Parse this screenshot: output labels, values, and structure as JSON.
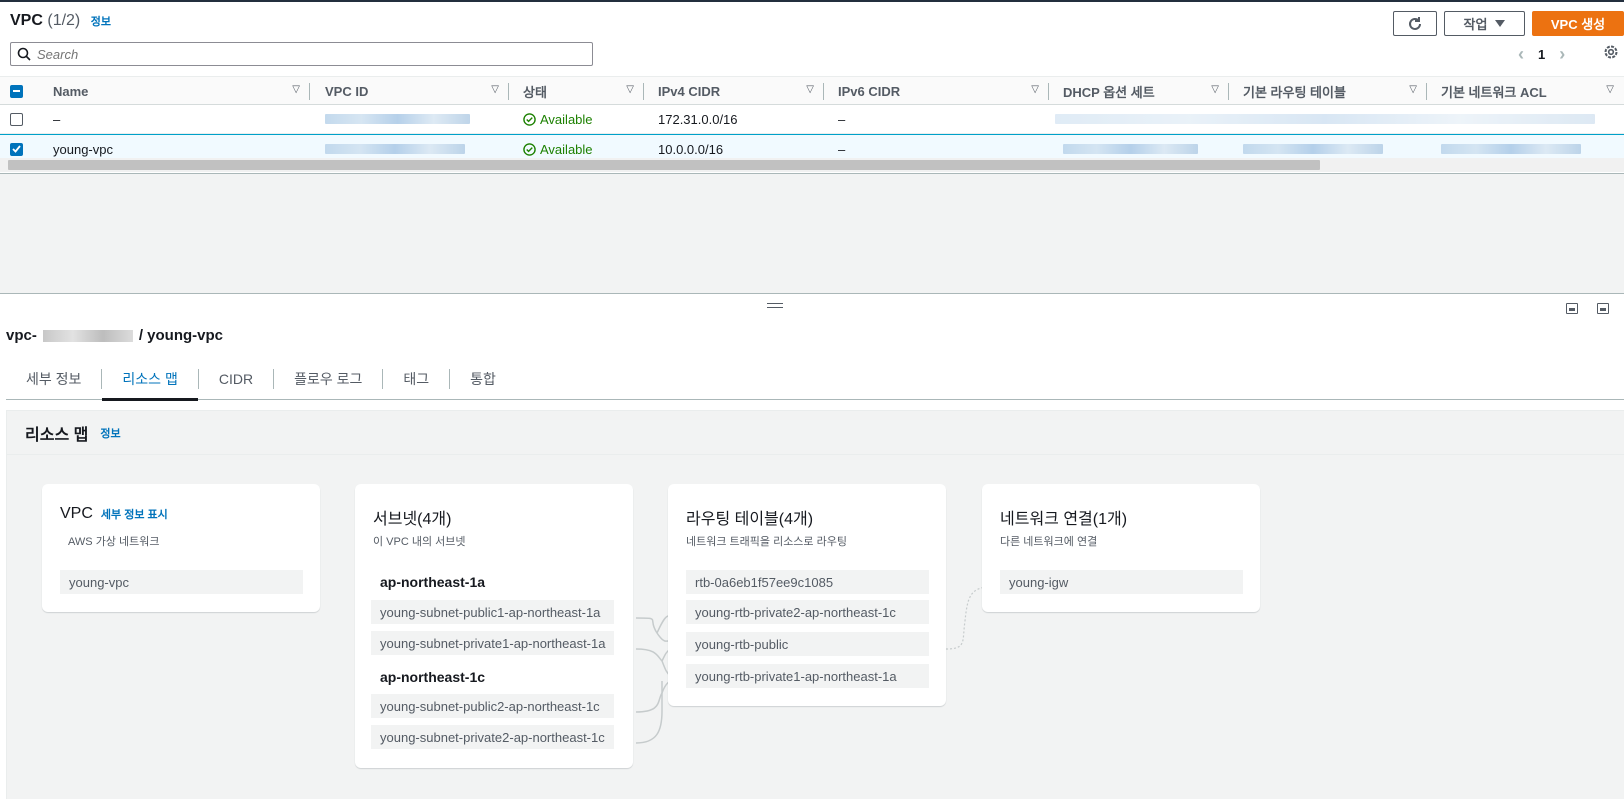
{
  "header": {
    "title": "VPC",
    "count": "(1/2)",
    "info": "정보",
    "actions_label": "작업",
    "create_label": "VPC 생성",
    "search_placeholder": "Search",
    "page": "1"
  },
  "table": {
    "columns": [
      "Name",
      "VPC ID",
      "상태",
      "IPv4 CIDR",
      "IPv6 CIDR",
      "DHCP 옵션 세트",
      "기본 라우팅 테이블",
      "기본 네트워크 ACL"
    ],
    "rows": [
      {
        "name": "–",
        "status": "Available",
        "ipv4": "172.31.0.0/16",
        "ipv6": "–",
        "selected": false
      },
      {
        "name": "young-vpc",
        "status": "Available",
        "ipv4": "10.0.0.0/16",
        "ipv6": "–",
        "selected": true
      }
    ]
  },
  "detail": {
    "id_prefix": "vpc-",
    "name": "/ young-vpc",
    "tabs": [
      "세부 정보",
      "리소스 맵",
      "CIDR",
      "플로우 로그",
      "태그",
      "통합"
    ],
    "active_tab": "리소스 맵"
  },
  "resource_map": {
    "title": "리소스 맵",
    "info": "정보",
    "vpc": {
      "title": "VPC",
      "link": "세부 정보 표시",
      "subtitle": "AWS 가상 네트워크",
      "items": [
        "young-vpc"
      ]
    },
    "subnets": {
      "title": "서브넷(4개)",
      "subtitle": "이 VPC 내의 서브넷",
      "az1": "ap-northeast-1a",
      "az1_items": [
        "young-subnet-public1-ap-northeast-1a",
        "young-subnet-private1-ap-northeast-1a"
      ],
      "az2": "ap-northeast-1c",
      "az2_items": [
        "young-subnet-public2-ap-northeast-1c",
        "young-subnet-private2-ap-northeast-1c"
      ]
    },
    "route_tables": {
      "title": "라우팅 테이블(4개)",
      "subtitle": "네트워크 트래픽을 리소스로 라우팅",
      "items": [
        "rtb-0a6eb1f57ee9c1085",
        "young-rtb-private2-ap-northeast-1c",
        "young-rtb-public",
        "young-rtb-private1-ap-northeast-1a"
      ]
    },
    "network": {
      "title": "네트워크 연결(1개)",
      "subtitle": "다른 네트워크에 연결",
      "items": [
        "young-igw"
      ]
    }
  }
}
